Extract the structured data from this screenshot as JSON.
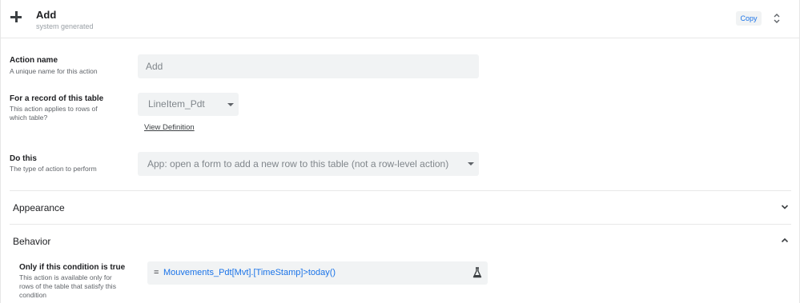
{
  "header": {
    "title": "Add",
    "subtitle": "system generated",
    "copy_label": "Copy"
  },
  "action_name": {
    "label": "Action name",
    "description": "A unique name for this action",
    "value": "Add"
  },
  "record_table": {
    "label": "For a record of this table",
    "description_line1": "This action applies to rows of",
    "description_line2": "which table?",
    "selected": "LineItem_Pdt",
    "link": "View Definition"
  },
  "do_this": {
    "label": "Do this",
    "description": "The type of action to perform",
    "selected": "App: open a form to add a new row to this table (not a row-level action)"
  },
  "sections": {
    "appearance": "Appearance",
    "behavior": "Behavior"
  },
  "condition": {
    "label": "Only if this condition is true",
    "description_line1": "This action is available only for",
    "description_line2": "rows of the table that satisfy this",
    "description_line3": "condition",
    "equals": "=",
    "expression": "Mouvements_Pdt[Mvt].[TimeStamp]>today()"
  },
  "icons": {
    "add": "plus-icon",
    "reorder": "unfold-icon",
    "select": "caret-down-icon",
    "expand": "chevron-down-icon",
    "collapse": "chevron-up-icon",
    "test": "flask-icon"
  }
}
